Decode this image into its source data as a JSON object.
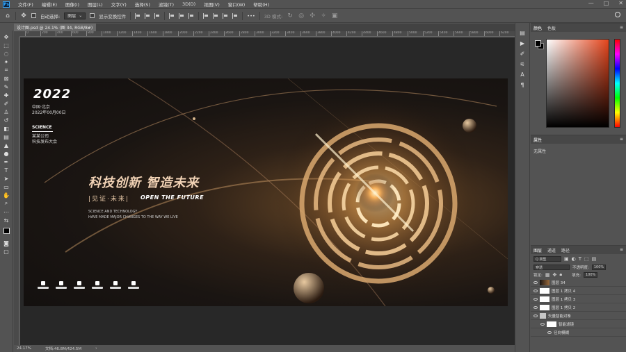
{
  "menubar": {
    "items": [
      "文件(F)",
      "编辑(E)",
      "图像(I)",
      "图层(L)",
      "文字(Y)",
      "选择(S)",
      "滤镜(T)",
      "3D(D)",
      "视图(V)",
      "窗口(W)",
      "帮助(H)"
    ],
    "window_controls": [
      "—",
      "□",
      "✕"
    ]
  },
  "options_bar": {
    "auto_select_label": "自动选择:",
    "auto_select_value": "图层",
    "show_transform_label": "显示变换控件",
    "more": "•••",
    "mode_3d_label": "3D 模式:"
  },
  "document": {
    "tab_title": "设计图.psd @ 24.1% (图 34, RGB/8#)",
    "close": "×",
    "ruler_ticks": [
      "0",
      "200",
      "400",
      "600",
      "800",
      "1000",
      "1200",
      "1400",
      "1600",
      "1800",
      "2000",
      "2200",
      "2400",
      "2600",
      "2800",
      "3000",
      "3200",
      "3400",
      "3600",
      "3800",
      "4000",
      "4200",
      "4400",
      "4600",
      "4800",
      "5000",
      "5200",
      "5400",
      "5600",
      "5800",
      "6000",
      "6200",
      "6400"
    ]
  },
  "artwork": {
    "year": "2022",
    "location": "中国·北京",
    "date": "2022年00月00日",
    "science_title": "SCIENCE",
    "company": "某某公司",
    "event": "科技发布大会",
    "slogan": "科技创新 智造未来",
    "witness": "|见证·未来|",
    "open_future": "OPEN THE FUTURE",
    "eng_line1": "SCIENCE AND TECHNOLOGY",
    "eng_line2": "HAVE MADE MAJOR CHANGES TO THE WAY WE LIVE"
  },
  "status": {
    "zoom": "24.17%",
    "doc_info": "文档:46.8M/424.5M"
  },
  "color_panel": {
    "tabs": [
      "颜色",
      "色板"
    ],
    "accent": "#e5451c"
  },
  "properties_panel": {
    "tabs": [
      "属性"
    ],
    "empty_text": "无属性"
  },
  "layers_panel": {
    "tabs": [
      "图层",
      "通道",
      "路径"
    ],
    "filter_kind": "Q 类型",
    "blend_mode": "穿透",
    "opacity_label": "不透明度:",
    "opacity_value": "100%",
    "lock_label": "锁定:",
    "fill_label": "填充:",
    "fill_value": "100%",
    "layers": [
      {
        "name": "图层 34",
        "thumb": "img"
      },
      {
        "name": "图层 1 拷贝 4",
        "thumb": "white"
      },
      {
        "name": "图层 1 拷贝 3",
        "thumb": "white"
      },
      {
        "name": "图层 1 拷贝 2",
        "thumb": "white"
      },
      {
        "name": "矢量智能对象",
        "thumb": "folder"
      },
      {
        "name": "智能滤镜",
        "thumb": "white"
      },
      {
        "name": "径向模糊",
        "thumb": "none"
      }
    ]
  }
}
